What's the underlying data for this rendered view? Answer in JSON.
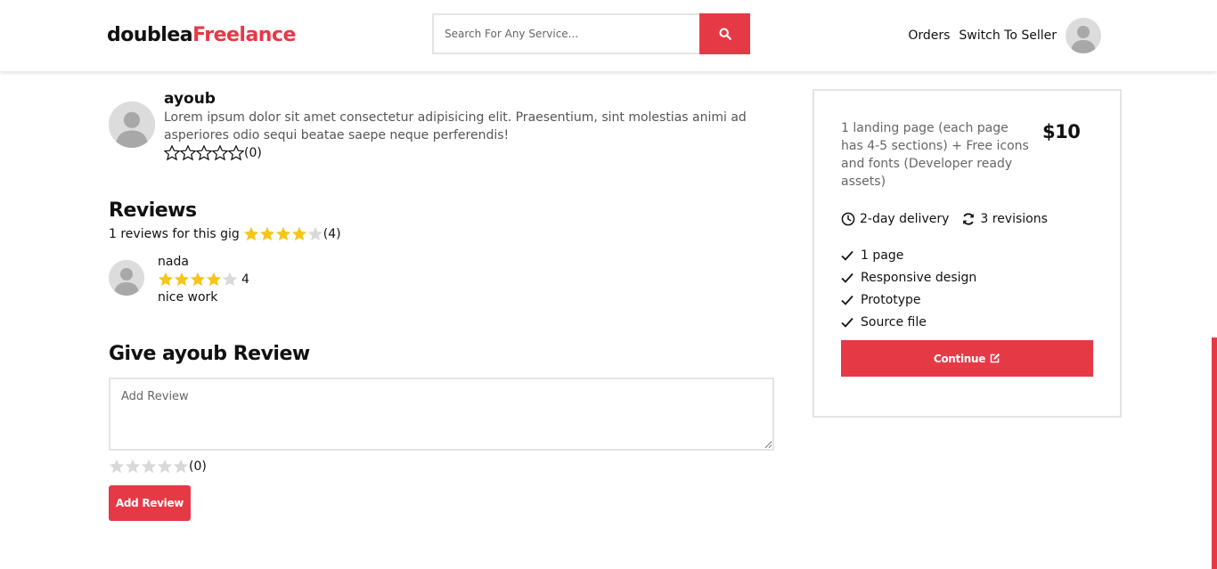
{
  "header": {
    "logo_main": "doublea",
    "logo_accent": "Freelance",
    "search_placeholder": "Search For Any Service...",
    "orders_label": "Orders",
    "switch_label": "Switch To Seller"
  },
  "seller": {
    "name": "ayoub",
    "bio": "Lorem ipsum dolor sit amet consectetur adipisicing elit. Praesentium, sint molestias animi ad asperiores odio sequi beatae saepe neque perferendis!",
    "rating_count": "(0)",
    "stars_filled": 0,
    "stars_total": 5
  },
  "reviews": {
    "title": "Reviews",
    "count_text": "1 reviews for this gig",
    "avg_stars_filled": 4,
    "avg_label": "(4)",
    "items": [
      {
        "user": "nada",
        "stars_filled": 4,
        "rating": "4",
        "comment": "nice work"
      }
    ]
  },
  "give_review": {
    "title": "Give ayoub Review",
    "placeholder": "Add Review",
    "rating_label": "(0)",
    "stars_filled": 0,
    "button_label": "Add Review"
  },
  "package": {
    "description": "1 landing page (each page has 4-5 sections) + Free icons and fonts (Developer ready assets)",
    "price": "$10",
    "delivery": "2-day delivery",
    "revisions": "3 revisions",
    "features": [
      "1 page",
      "Responsive design",
      "Prototype",
      "Source file"
    ],
    "continue_label": "Continue"
  },
  "colors": {
    "accent": "#e63946",
    "star": "#f5c518",
    "star_empty": "#d9d9d9"
  },
  "icons": {
    "search": "search-icon",
    "avatar": "user-avatar-icon",
    "clock": "clock-icon",
    "refresh": "refresh-icon",
    "check": "check-icon",
    "edit": "edit-icon",
    "star": "star-icon"
  }
}
